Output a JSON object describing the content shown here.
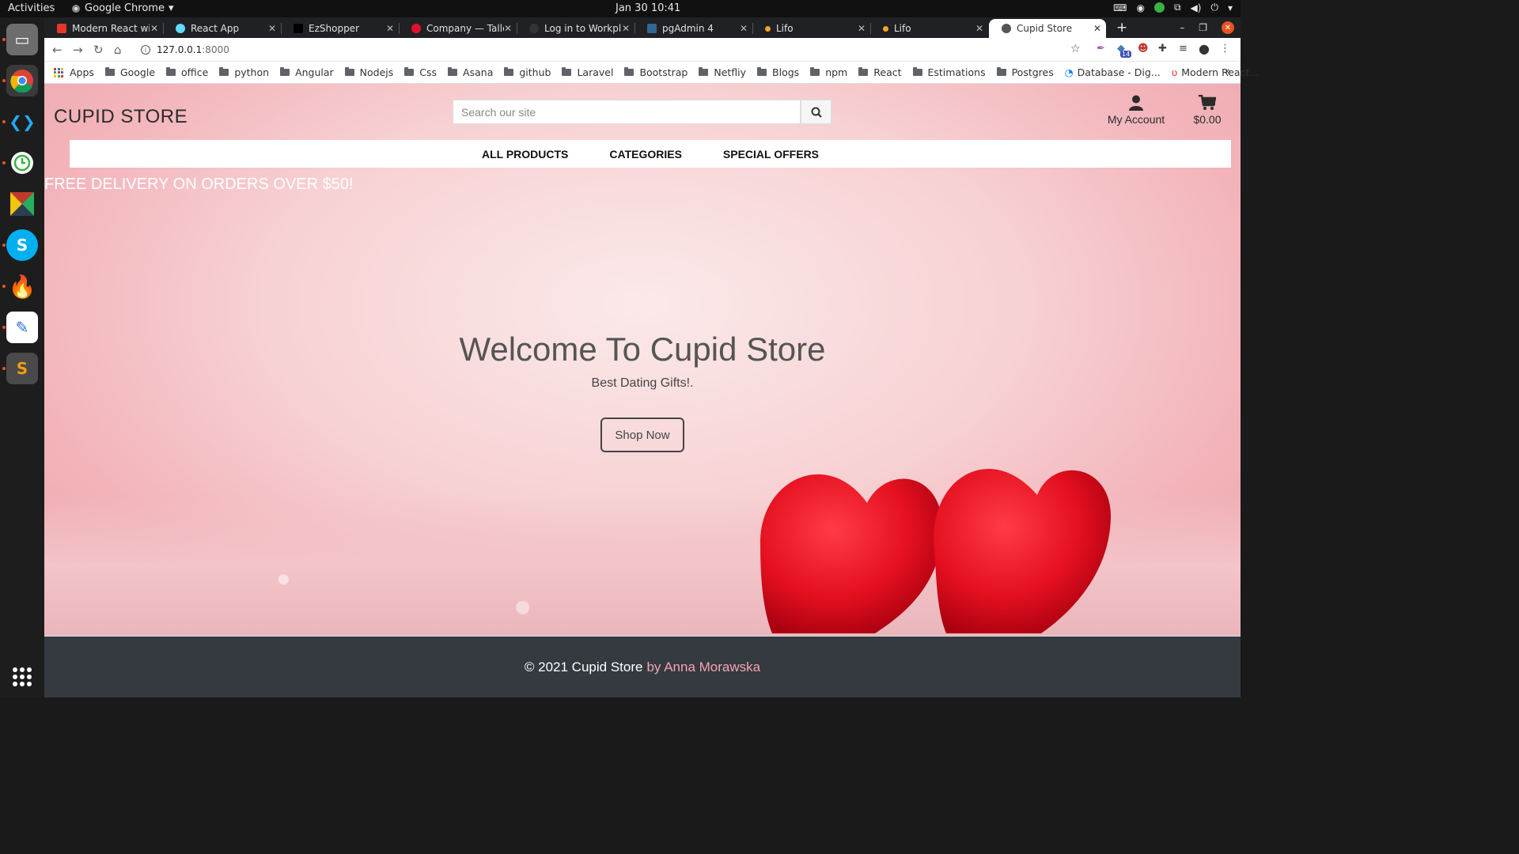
{
  "topbar": {
    "activities": "Activities",
    "app_name": "Google Chrome",
    "clock": "Jan 30  10:41"
  },
  "tabs": [
    {
      "label": "Modern React wi",
      "fav_color": "#e5372b"
    },
    {
      "label": "React App",
      "fav_color": "#61dafb"
    },
    {
      "label": "EzShopper",
      "fav_color": "#000000"
    },
    {
      "label": "Company — Tallo",
      "fav_color": "#e0132a"
    },
    {
      "label": "Log in to Workpl",
      "fav_color": "#333333"
    },
    {
      "label": "pgAdmin 4",
      "fav_color": "#336791"
    },
    {
      "label": "Lifo",
      "fav_color": "#f5a623"
    },
    {
      "label": "Lifo",
      "fav_color": "#f5a623"
    },
    {
      "label": "Cupid Store",
      "fav_color": "#555555"
    }
  ],
  "address": {
    "host": "127.0.0.1",
    "port": ":8000"
  },
  "bookmarks": {
    "apps": "Apps",
    "folders": [
      "Google",
      "office",
      "python",
      "Angular",
      "Nodejs",
      "Css",
      "Asana",
      "github",
      "Laravel",
      "Bootstrap",
      "Netfliy",
      "Blogs",
      "npm",
      "React",
      "Estimations",
      "Postgres"
    ],
    "db_link": "Database - Dig...",
    "react_link": "Modern React...",
    "more": "»"
  },
  "store": {
    "brand": "CUPID STORE",
    "search_placeholder": "Search our site",
    "account_label": "My Account",
    "cart_total": "$0.00",
    "nav": [
      "ALL PRODUCTS",
      "CATEGORIES",
      "SPECIAL OFFERS"
    ],
    "promo": "FREE DELIVERY ON ORDERS OVER $50!",
    "welcome": "Welcome To Cupid Store",
    "tagline": "Best Dating Gifts!.",
    "cta": "Shop Now",
    "footer_copy": "© 2021 Cupid Store",
    "footer_author": "by Anna Morawska"
  },
  "icons": {
    "search": "search-icon",
    "account": "user-icon",
    "cart": "cart-icon"
  },
  "colors": {
    "brand_text": "#2b2b2b",
    "footer_bg": "#343a40",
    "author_pink": "#f4a4b1",
    "hero_pink": "#f2b3b9"
  }
}
